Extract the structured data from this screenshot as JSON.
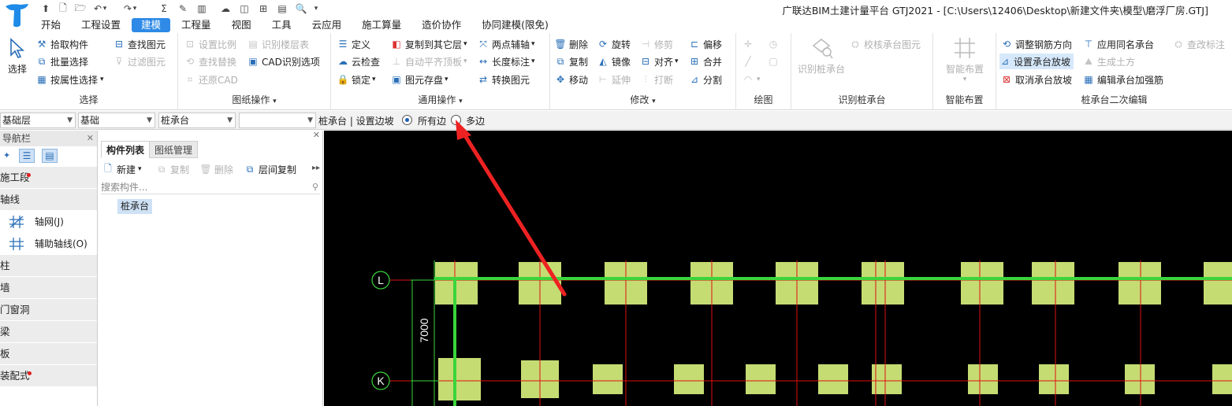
{
  "window": {
    "title": "广联达BIM土建计量平台 GTJ2021 - [C:\\Users\\12406\\Desktop\\新建文件夹\\模型\\磨浮厂房.GTJ]"
  },
  "menu": {
    "tabs": [
      "开始",
      "工程设置",
      "建模",
      "工程量",
      "视图",
      "工具",
      "云应用",
      "施工算量",
      "造价协作",
      "协同建模(限免)"
    ],
    "active": "建模"
  },
  "ribbon": {
    "select": {
      "label": "选择",
      "big": "选择",
      "items": [
        "拾取构件",
        "批量选择",
        "按属性选择",
        "查找图元",
        "过滤图元"
      ]
    },
    "drawing_ops": {
      "label": "图纸操作",
      "items": [
        "设置比例",
        "识别楼层表",
        "查找替换",
        "CAD识别选项",
        "还原CAD"
      ]
    },
    "common_ops": {
      "label": "通用操作",
      "items": [
        "定义",
        "复制到其它层",
        "两点辅轴",
        "云检查",
        "自动平齐顶板",
        "长度标注",
        "锁定",
        "图元存盘",
        "转换图元"
      ]
    },
    "modify": {
      "label": "修改",
      "items": [
        "删除",
        "旋转",
        "修剪",
        "偏移",
        "复制",
        "镜像",
        "对齐",
        "合并",
        "移动",
        "延伸",
        "打断",
        "分割"
      ]
    },
    "draw": {
      "label": "绘图"
    },
    "identify": {
      "label": "识别桩承台",
      "big": "识别桩承台",
      "items": [
        "校核承台图元"
      ]
    },
    "smart": {
      "label": "智能布置",
      "big": "智能布置"
    },
    "secondary": {
      "label": "桩承台二次编辑",
      "items": [
        "调整钢筋方向",
        "应用同名承台",
        "查改标注",
        "设置承台放坡",
        "生成土方",
        "取消承台放坡",
        "编辑承台加强筋"
      ]
    }
  },
  "toolbar2": {
    "floor": "基础层",
    "type": "基础",
    "component": "桩承台",
    "extra": "",
    "status": "桩承台 | 设置边坡",
    "radio_all": "所有边",
    "radio_multi": "多边"
  },
  "nav": {
    "title": "导航栏",
    "categories": [
      "施工段",
      "轴线",
      "柱",
      "墙",
      "门窗洞",
      "梁",
      "板",
      "装配式"
    ],
    "axis_items": [
      "轴网(J)",
      "辅助轴线(O)"
    ]
  },
  "components": {
    "tabs": [
      "构件列表",
      "图纸管理"
    ],
    "new": "新建",
    "copy": "复制",
    "delete": "删除",
    "floor_copy": "层间复制",
    "search_placeholder": "搜索构件...",
    "item": "桩承台"
  },
  "canvas": {
    "axis_labels": [
      "L",
      "K"
    ],
    "dimension": "7000",
    "colors": {
      "cap": "#c5dc73",
      "grid_red": "#e01010",
      "beam_green": "#3bd43b",
      "background": "#000000"
    }
  }
}
